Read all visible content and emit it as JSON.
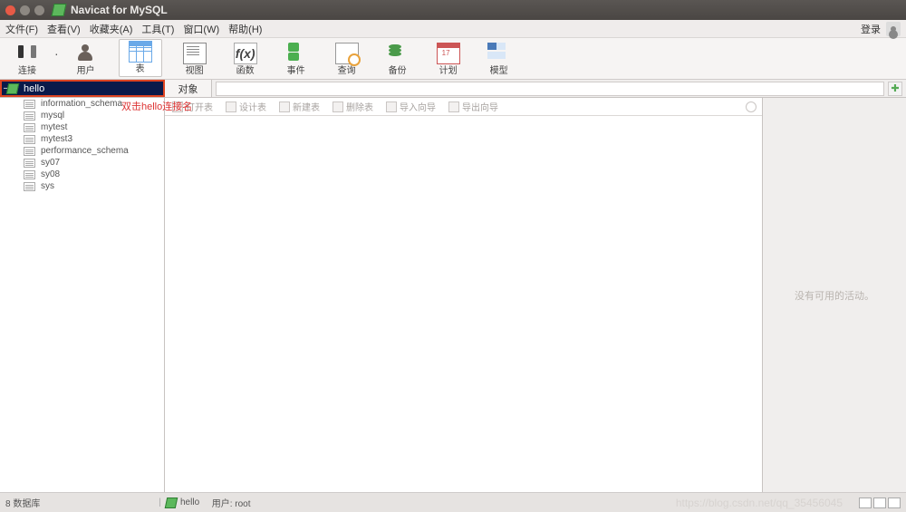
{
  "window": {
    "title": "Navicat for MySQL"
  },
  "menu": {
    "file": "文件(F)",
    "view": "查看(V)",
    "favorites": "收藏夹(A)",
    "tools": "工具(T)",
    "window": "窗口(W)",
    "help": "帮助(H)",
    "login": "登录"
  },
  "toolbar": {
    "connection": "连接",
    "user": "用户",
    "table": "表",
    "view": "视图",
    "function": "函数",
    "event": "事件",
    "query": "查询",
    "backup": "备份",
    "schedule": "计划",
    "model": "模型",
    "fx_glyph": "f(x)"
  },
  "tabs": {
    "connection_name": "hello",
    "objects": "对象"
  },
  "annotation": "双击hello连接名",
  "actionbar": {
    "open_table": "打开表",
    "design_table": "设计表",
    "new_table": "新建表",
    "delete_table": "删除表",
    "import_wizard": "导入向导",
    "export_wizard": "导出向导"
  },
  "sidebar": {
    "items": [
      {
        "label": "information_schema"
      },
      {
        "label": "mysql"
      },
      {
        "label": "mytest"
      },
      {
        "label": "mytest3"
      },
      {
        "label": "performance_schema"
      },
      {
        "label": "sy07"
      },
      {
        "label": "sy08"
      },
      {
        "label": "sys"
      }
    ]
  },
  "rightpane": {
    "empty_text": "没有可用的活动。"
  },
  "status": {
    "db_count": "8  数据库",
    "conn": "hello",
    "user_label": "用户: root",
    "watermark": "https://blog.csdn.net/qq_35456045"
  },
  "search": {
    "placeholder": ""
  }
}
